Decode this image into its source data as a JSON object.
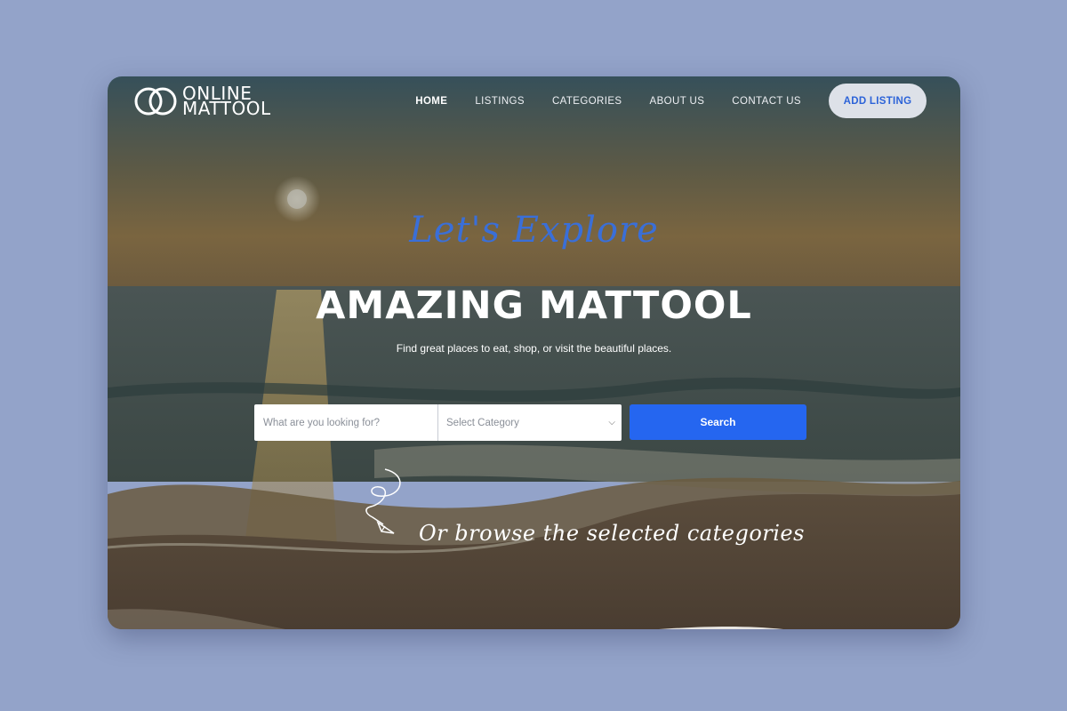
{
  "brand": {
    "line1": "ONLINE",
    "line2": "MATTOOL"
  },
  "nav": {
    "items": [
      {
        "label": "HOME",
        "active": true
      },
      {
        "label": "LISTINGS",
        "active": false
      },
      {
        "label": "CATEGORIES",
        "active": false
      },
      {
        "label": "ABOUT US",
        "active": false
      },
      {
        "label": "CONTACT US",
        "active": false
      }
    ],
    "cta": "ADD LISTING"
  },
  "hero": {
    "script_heading": "Let's Explore",
    "title": "AMAZING MATTOOL",
    "subtitle": "Find great places to eat, shop, or visit the beautiful places."
  },
  "search": {
    "placeholder": "What are you looking for?",
    "category_value": "Select Category",
    "button_label": "Search"
  },
  "browse": {
    "text": "Or browse the selected categories"
  },
  "colors": {
    "accent": "#2566f0",
    "script": "#3a6fd8",
    "page_bg": "#93a3c9"
  }
}
